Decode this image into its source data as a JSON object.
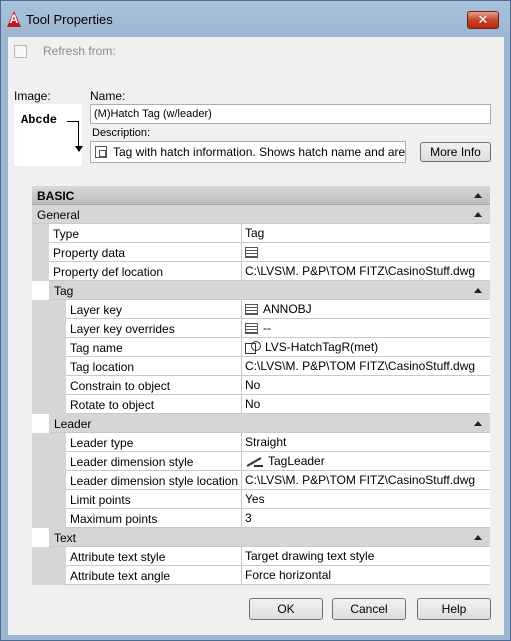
{
  "window": {
    "title": "Tool Properties",
    "close_glyph": "✕",
    "app_icon_glyph": "A"
  },
  "refresh": {
    "label": "Refresh from:",
    "checked": false
  },
  "image": {
    "label": "Image:",
    "preview_text": "Abcde"
  },
  "name": {
    "label": "Name:",
    "value": "(M)Hatch Tag (w/leader)"
  },
  "description": {
    "label": "Description:",
    "value": "Tag with hatch information.  Shows hatch name and are"
  },
  "more_info_label": "More Info",
  "grid": {
    "basic": {
      "label": "BASIC"
    },
    "general": {
      "label": "General",
      "rows": [
        {
          "name": "Type",
          "value": "Tag",
          "icon": ""
        },
        {
          "name": "Property data",
          "value": "",
          "icon": "list-icon"
        },
        {
          "name": "Property def location",
          "value": "C:\\LVS\\M. P&P\\TOM FITZ\\CasinoStuff.dwg",
          "icon": ""
        }
      ]
    },
    "tag": {
      "label": "Tag",
      "rows": [
        {
          "name": "Layer key",
          "value": "ANNOBJ",
          "icon": "list-icon"
        },
        {
          "name": "Layer key overrides",
          "value": "--",
          "icon": "list-icon"
        },
        {
          "name": "Tag name",
          "value": "LVS-HatchTagR(met)",
          "icon": "tag-icon"
        },
        {
          "name": "Tag location",
          "value": "C:\\LVS\\M. P&P\\TOM FITZ\\CasinoStuff.dwg",
          "icon": ""
        },
        {
          "name": "Constrain to object",
          "value": "No",
          "icon": ""
        },
        {
          "name": "Rotate to object",
          "value": "No",
          "icon": ""
        }
      ]
    },
    "leader": {
      "label": "Leader",
      "rows": [
        {
          "name": "Leader type",
          "value": "Straight",
          "icon": ""
        },
        {
          "name": "Leader dimension style",
          "value": "TagLeader",
          "icon": "leader-icon"
        },
        {
          "name": "Leader dimension style location",
          "value": "C:\\LVS\\M. P&P\\TOM FITZ\\CasinoStuff.dwg",
          "icon": ""
        },
        {
          "name": "Limit points",
          "value": "Yes",
          "icon": ""
        },
        {
          "name": "Maximum points",
          "value": "3",
          "icon": ""
        }
      ]
    },
    "text": {
      "label": "Text",
      "rows": [
        {
          "name": "Attribute text style",
          "value": "Target drawing text style",
          "icon": ""
        },
        {
          "name": "Attribute text angle",
          "value": "Force horizontal",
          "icon": ""
        }
      ]
    }
  },
  "buttons": {
    "ok": "OK",
    "cancel": "Cancel",
    "help": "Help"
  }
}
